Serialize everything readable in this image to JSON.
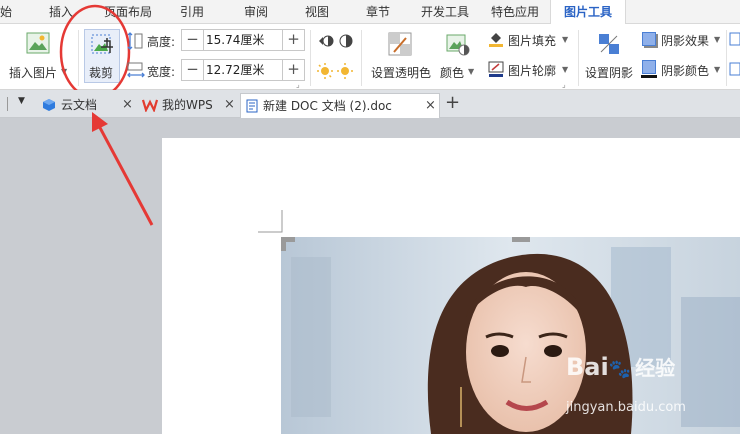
{
  "menubar": {
    "items": [
      {
        "label": "始"
      },
      {
        "label": "插入"
      },
      {
        "label": "页面布局"
      },
      {
        "label": "引用"
      },
      {
        "label": "审阅"
      },
      {
        "label": "视图"
      },
      {
        "label": "章节"
      },
      {
        "label": "开发工具"
      },
      {
        "label": "特色应用"
      },
      {
        "label": "图片工具"
      }
    ]
  },
  "ribbon": {
    "insert_picture_label": "插入图片",
    "crop_label": "裁剪",
    "height_label": "高度:",
    "height_value": "15.74厘米",
    "width_label": "宽度:",
    "width_value": "12.72厘米",
    "set_transparent_label": "设置透明色",
    "color_label": "颜色",
    "picture_fill_label": "图片填充",
    "picture_outline_label": "图片轮廓",
    "set_shadow_label": "设置阴影",
    "shadow_effect_label": "阴影效果",
    "shadow_color_label": "阴影颜色",
    "spin_minus": "−",
    "spin_plus": "+"
  },
  "tabs": [
    {
      "label": "云文档",
      "close": "×"
    },
    {
      "label": "我的WPS",
      "close": "×"
    },
    {
      "label": "新建 DOC 文档 (2).doc",
      "close": "×"
    }
  ],
  "tabbar": {
    "new_tab": "+",
    "dropdown": "▼"
  },
  "watermark": {
    "brand": "Bai",
    "brand_tail": "经验",
    "domain": "jingyan.baidu.com"
  },
  "colors": {
    "accent": "#2b64c5",
    "annotation": "#e53935",
    "canvas": "#c9ccd1"
  }
}
